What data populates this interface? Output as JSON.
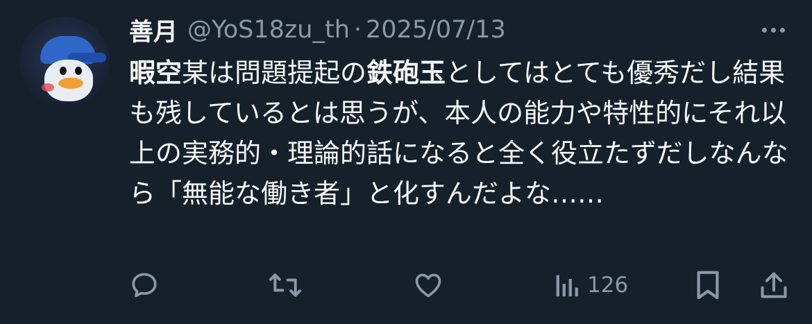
{
  "post": {
    "author_name": "善月",
    "author_handle": "@YoS18zu_th",
    "separator": "·",
    "date": "2025/07/13",
    "body": {
      "bold_1": "暇空",
      "text_1": "某は問題提起の",
      "bold_2": "鉄砲玉",
      "text_2": "としてはとても優秀だし結果も残しているとは思うが、本人の能力や特性的にそれ以上の実務的・理論的話になると全く役立たずだしなんなら「無能な働き者」と化すんだよな……"
    }
  },
  "actions": {
    "views": "126"
  },
  "colors": {
    "background": "#15202b",
    "text": "#f7f9f9",
    "muted": "#8b98a5"
  },
  "icons": [
    "reply-icon",
    "retweet-icon",
    "like-icon",
    "views-icon",
    "bookmark-icon",
    "share-icon",
    "more-icon"
  ]
}
